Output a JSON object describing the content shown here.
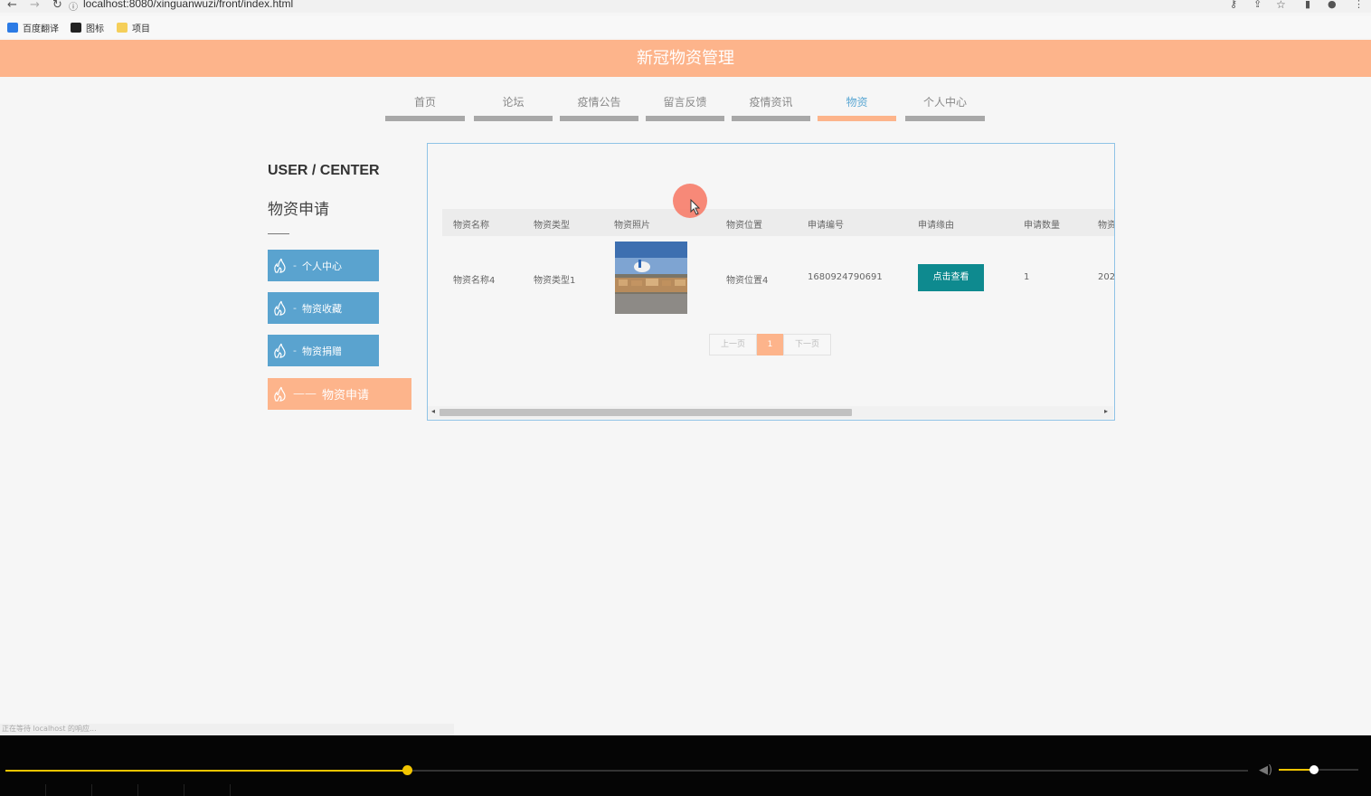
{
  "browser": {
    "url": "localhost:8080/xinguanwuzi/front/index.html",
    "bookmarks": [
      "百度翻译",
      "图标",
      "项目"
    ]
  },
  "header": {
    "title": "新冠物资管理"
  },
  "nav": {
    "tabs": [
      {
        "label": "首页"
      },
      {
        "label": "论坛"
      },
      {
        "label": "疫情公告"
      },
      {
        "label": "留言反馈"
      },
      {
        "label": "疫情资讯"
      },
      {
        "label": "物资",
        "active": true
      },
      {
        "label": "个人中心"
      }
    ]
  },
  "sidebar": {
    "title": "USER / CENTER",
    "subtitle": "物资申请",
    "items": [
      {
        "label": "个人中心"
      },
      {
        "label": "物资收藏"
      },
      {
        "label": "物资捐赠"
      },
      {
        "label": "物资申请",
        "active": true
      }
    ]
  },
  "table": {
    "columns": [
      "物资名称",
      "物资类型",
      "物资照片",
      "物资位置",
      "申请编号",
      "申请缘由",
      "申请数量",
      "物资"
    ],
    "row": {
      "name": "物资名称4",
      "type": "物资类型1",
      "location": "物资位置4",
      "apply_no": "1680924790691",
      "reason_button": "点击查看",
      "quantity": "1",
      "date": "202"
    }
  },
  "pagination": {
    "prev": "上一页",
    "current": "1",
    "next": "下一页"
  },
  "status_bar": "正在等待 localhost 的响应...",
  "player": {
    "progress_fraction": 0.32,
    "volume_fraction": 0.44
  },
  "colors": {
    "header": "#fdb48b",
    "sidebar": "#5aa3cf",
    "button": "#0e8a8f",
    "player_accent": "#f2c500"
  }
}
